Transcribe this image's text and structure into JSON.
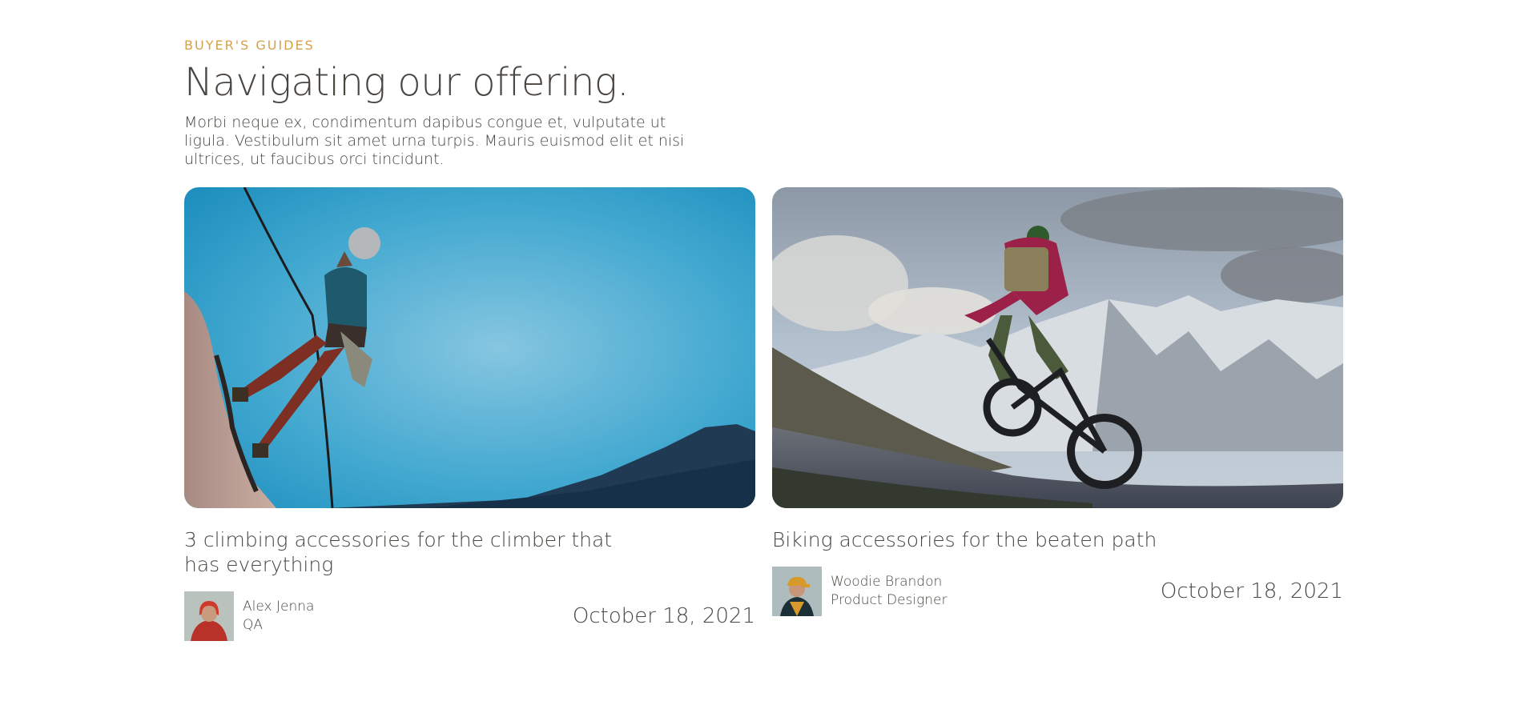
{
  "section": {
    "eyebrow": "BUYER'S GUIDES",
    "heading": "Navigating our offering.",
    "lede": "Morbi neque ex, condimentum dapibus congue et, vulputate ut ligula. Vestibulum sit amet urna turpis. Mauris euismod elit et nisi ultrices, ut faucibus orci tincidunt."
  },
  "cards": [
    {
      "title": "3 climbing accessories for the climber that has everything",
      "author_name": "Alex Jenna",
      "author_role": "QA",
      "date": "October 18, 2021",
      "image": "rock-climber-photo"
    },
    {
      "title": "Biking accessories for the beaten path",
      "author_name": "Woodie Brandon",
      "author_role": "Product Designer",
      "date": "October 18, 2021",
      "image": "mountain-biker-photo"
    }
  ],
  "colors": {
    "accent": "#d4a24c",
    "text": "#4a4540",
    "sky": "#2e9cc6"
  }
}
